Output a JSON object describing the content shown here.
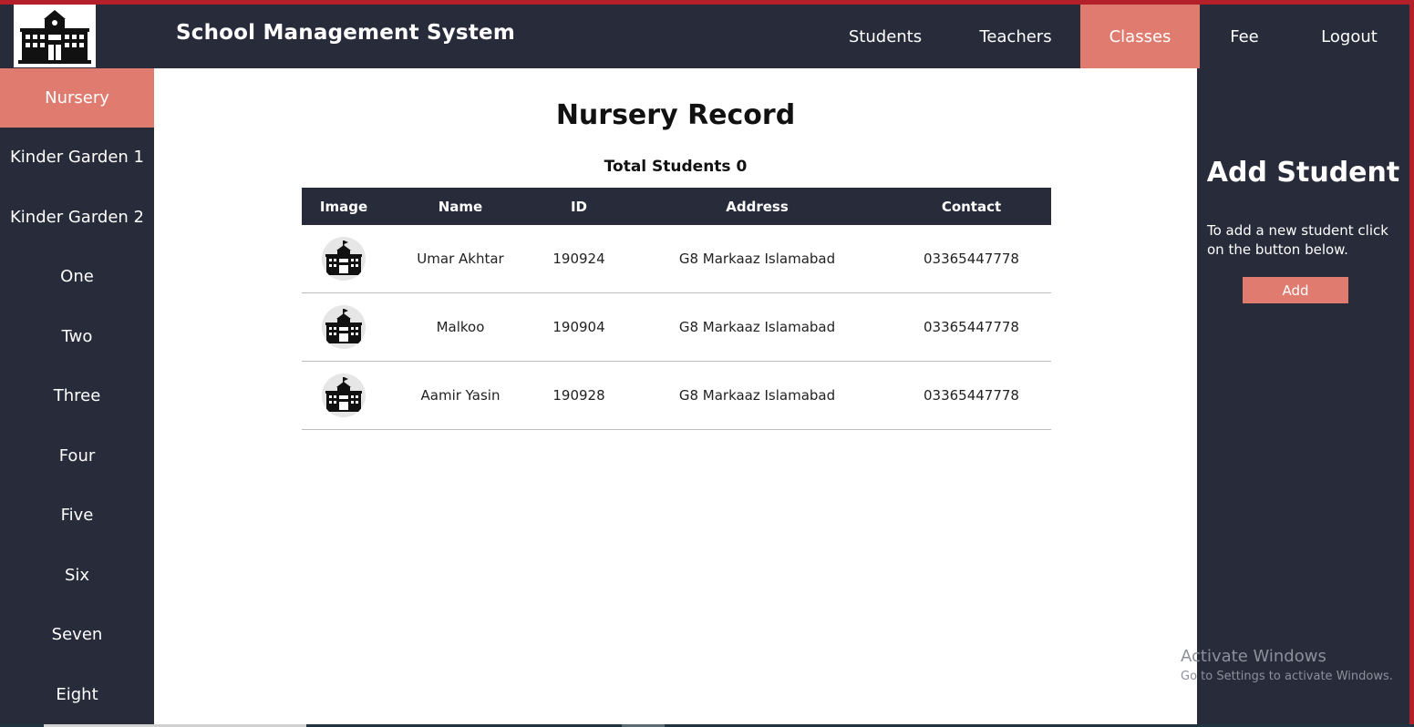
{
  "header": {
    "title": "School Management System",
    "nav": [
      {
        "label": "Students",
        "active": false
      },
      {
        "label": "Teachers",
        "active": false
      },
      {
        "label": "Classes",
        "active": true
      },
      {
        "label": "Fee",
        "active": false
      },
      {
        "label": "Logout",
        "active": false
      }
    ]
  },
  "sidebar": {
    "items": [
      {
        "label": "Nursery",
        "active": true
      },
      {
        "label": "Kinder Garden 1",
        "active": false
      },
      {
        "label": "Kinder Garden 2",
        "active": false
      },
      {
        "label": "One",
        "active": false
      },
      {
        "label": "Two",
        "active": false
      },
      {
        "label": "Three",
        "active": false
      },
      {
        "label": "Four",
        "active": false
      },
      {
        "label": "Five",
        "active": false
      },
      {
        "label": "Six",
        "active": false
      },
      {
        "label": "Seven",
        "active": false
      },
      {
        "label": "Eight",
        "active": false
      }
    ]
  },
  "main": {
    "title": "Nursery Record",
    "total_label": "Total Students 0",
    "table": {
      "headers": [
        "Image",
        "Name",
        "ID",
        "Address",
        "Contact"
      ],
      "rows": [
        {
          "image": "school-icon",
          "name": "Umar Akhtar",
          "id": "190924",
          "address": "G8 Markaaz Islamabad",
          "contact": "03365447778"
        },
        {
          "image": "school-icon",
          "name": "Malkoo",
          "id": "190904",
          "address": "G8 Markaaz Islamabad",
          "contact": "03365447778"
        },
        {
          "image": "school-icon",
          "name": "Aamir Yasin",
          "id": "190928",
          "address": "G8 Markaaz Islamabad",
          "contact": "03365447778"
        }
      ]
    }
  },
  "right_panel": {
    "title": "Add Student",
    "description": "To add a new student click on the button below.",
    "button_label": "Add"
  },
  "watermark": {
    "line1": "Activate Windows",
    "line2": "Go to Settings to activate Windows."
  },
  "colors": {
    "dark": "#272b3a",
    "accent": "#e07b6f",
    "border_red": "#b3202a"
  }
}
